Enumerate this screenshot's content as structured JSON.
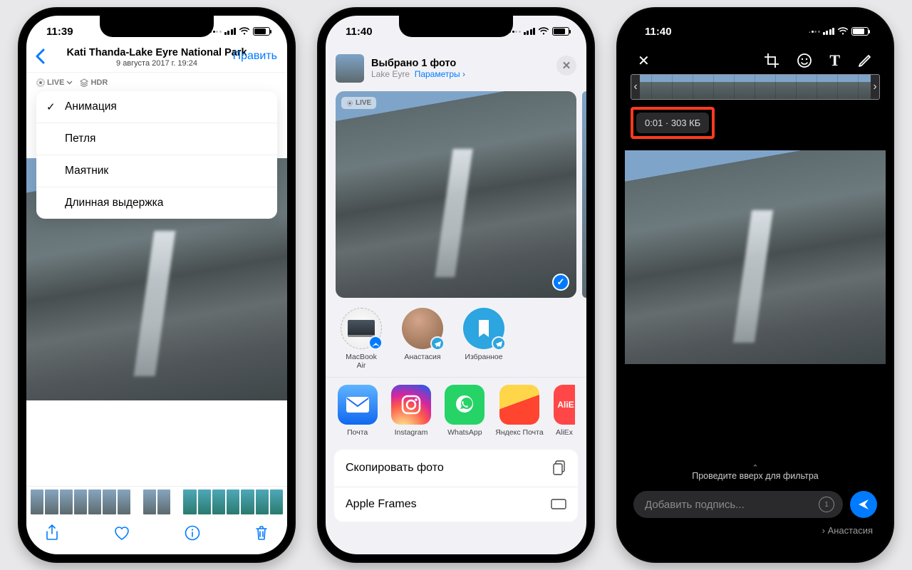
{
  "phone1": {
    "status_time": "11:39",
    "title": "Kati Thanda-Lake Eyre National Park",
    "subtitle": "9 августа 2017 г.  19:24",
    "edit_label": "Править",
    "live_badge": "LIVE",
    "hdr_badge": "HDR",
    "menu": [
      "Анимация",
      "Петля",
      "Маятник",
      "Длинная выдержка"
    ],
    "menu_selected_index": 0
  },
  "phone2": {
    "status_time": "11:40",
    "sheet_title": "Выбрано 1 фото",
    "sheet_location": "Lake Eyre",
    "sheet_params": "Параметры",
    "live_badge": "LIVE",
    "share_targets": [
      {
        "name": "MacBook\nAir"
      },
      {
        "name": "Анастасия"
      },
      {
        "name": "Избранное"
      }
    ],
    "apps": [
      {
        "name": "Почта",
        "bg": "#1f6afc"
      },
      {
        "name": "Instagram",
        "bg": "ig"
      },
      {
        "name": "WhatsApp",
        "bg": "#25d366"
      },
      {
        "name": "Яндекс Почта",
        "bg": "#ff3b30"
      },
      {
        "name": "AliEx",
        "bg": "#ff4747"
      }
    ],
    "actions": [
      "Скопировать фото",
      "Apple Frames"
    ]
  },
  "phone3": {
    "status_time": "11:40",
    "info_text": "0:01 · 303 КБ",
    "swipe_hint": "Проведите вверх для фильтра",
    "caption_placeholder": "Добавить подпись...",
    "recipient": "Анастасия"
  }
}
